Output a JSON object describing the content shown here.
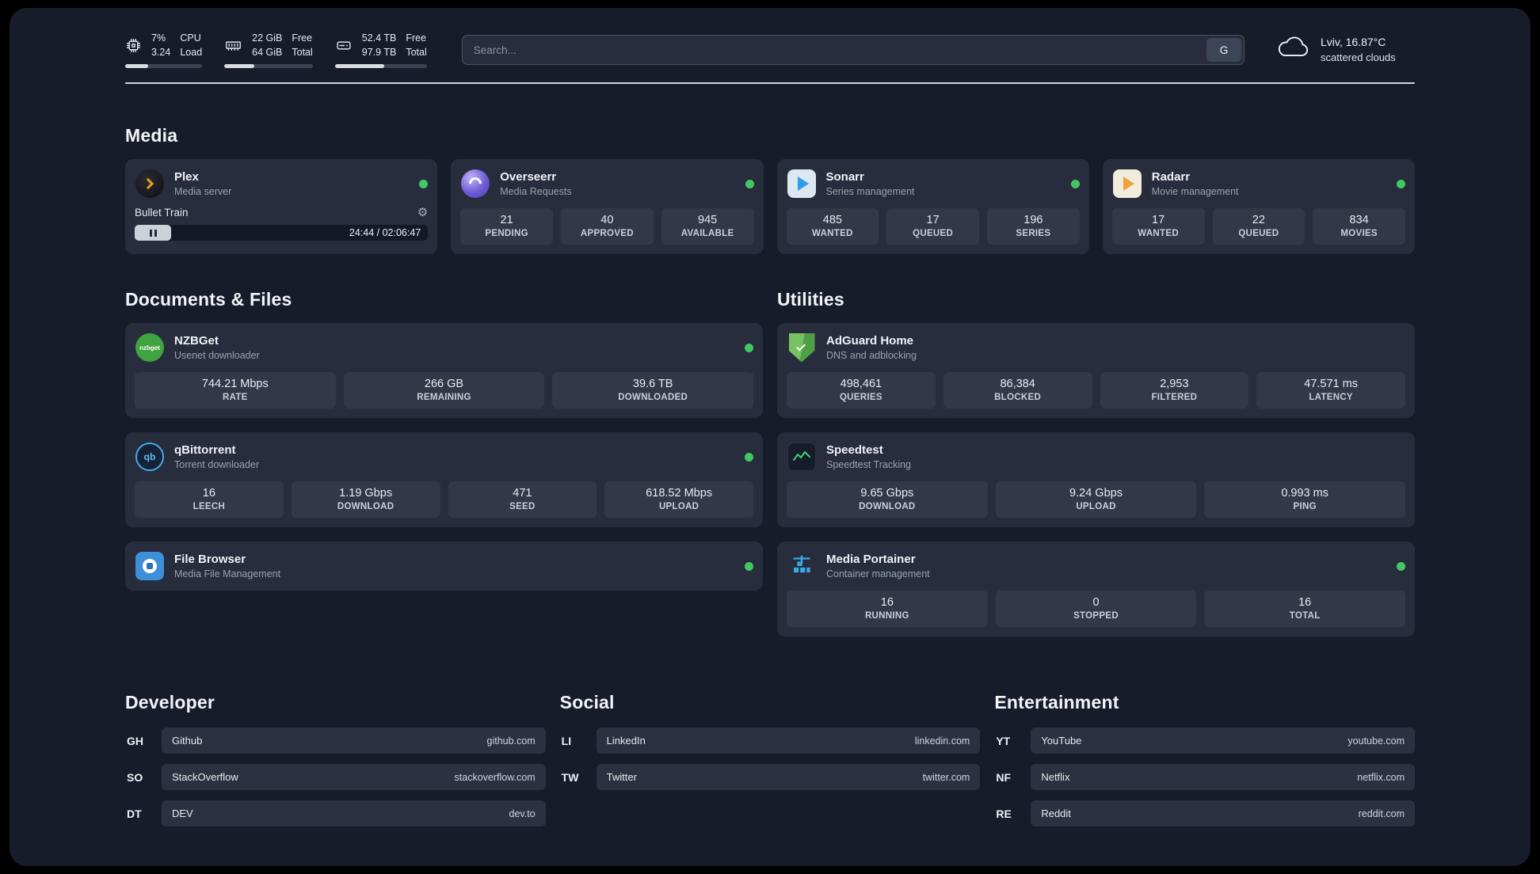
{
  "topbar": {
    "cpu": {
      "value_top": "7%",
      "value_bottom": "3.24",
      "label_top": "CPU",
      "label_bottom": "Load"
    },
    "memory": {
      "value_top": "22 GiB",
      "value_bottom": "64 GiB",
      "label_top": "Free",
      "label_bottom": "Total"
    },
    "disk": {
      "value_top": "52.4 TB",
      "value_bottom": "97.9 TB",
      "label_top": "Free",
      "label_bottom": "Total"
    },
    "search": {
      "placeholder": "Search...",
      "engine_button": "G"
    },
    "weather": {
      "location": "Lviv, 16.87°C",
      "condition": "scattered clouds"
    }
  },
  "media": {
    "title": "Media",
    "plex": {
      "name": "Plex",
      "subtitle": "Media server",
      "now_playing": "Bullet Train",
      "time": "24:44 / 02:06:47"
    },
    "overseerr": {
      "name": "Overseerr",
      "subtitle": "Media Requests",
      "stats": [
        {
          "value": "21",
          "label": "PENDING"
        },
        {
          "value": "40",
          "label": "APPROVED"
        },
        {
          "value": "945",
          "label": "AVAILABLE"
        }
      ]
    },
    "sonarr": {
      "name": "Sonarr",
      "subtitle": "Series management",
      "stats": [
        {
          "value": "485",
          "label": "WANTED"
        },
        {
          "value": "17",
          "label": "QUEUED"
        },
        {
          "value": "196",
          "label": "SERIES"
        }
      ]
    },
    "radarr": {
      "name": "Radarr",
      "subtitle": "Movie management",
      "stats": [
        {
          "value": "17",
          "label": "WANTED"
        },
        {
          "value": "22",
          "label": "QUEUED"
        },
        {
          "value": "834",
          "label": "MOVIES"
        }
      ]
    }
  },
  "documents": {
    "title": "Documents & Files",
    "nzbget": {
      "name": "NZBGet",
      "subtitle": "Usenet downloader",
      "stats": [
        {
          "value": "744.21 Mbps",
          "label": "RATE"
        },
        {
          "value": "266 GB",
          "label": "REMAINING"
        },
        {
          "value": "39.6 TB",
          "label": "DOWNLOADED"
        }
      ]
    },
    "qbittorrent": {
      "name": "qBittorrent",
      "subtitle": "Torrent downloader",
      "stats": [
        {
          "value": "16",
          "label": "LEECH"
        },
        {
          "value": "1.19 Gbps",
          "label": "DOWNLOAD"
        },
        {
          "value": "471",
          "label": "SEED"
        },
        {
          "value": "618.52 Mbps",
          "label": "UPLOAD"
        }
      ]
    },
    "filebrowser": {
      "name": "File Browser",
      "subtitle": "Media File Management"
    }
  },
  "utilities": {
    "title": "Utilities",
    "adguard": {
      "name": "AdGuard Home",
      "subtitle": "DNS and adblocking",
      "stats": [
        {
          "value": "498,461",
          "label": "QUERIES"
        },
        {
          "value": "86,384",
          "label": "BLOCKED"
        },
        {
          "value": "2,953",
          "label": "FILTERED"
        },
        {
          "value": "47.571 ms",
          "label": "LATENCY"
        }
      ]
    },
    "speedtest": {
      "name": "Speedtest",
      "subtitle": "Speedtest Tracking",
      "stats": [
        {
          "value": "9.65 Gbps",
          "label": "DOWNLOAD"
        },
        {
          "value": "9.24 Gbps",
          "label": "UPLOAD"
        },
        {
          "value": "0.993 ms",
          "label": "PING"
        }
      ]
    },
    "portainer": {
      "name": "Media Portainer",
      "subtitle": "Container management",
      "stats": [
        {
          "value": "16",
          "label": "RUNNING"
        },
        {
          "value": "0",
          "label": "STOPPED"
        },
        {
          "value": "16",
          "label": "TOTAL"
        }
      ]
    }
  },
  "bookmarks": {
    "developer": {
      "title": "Developer",
      "items": [
        {
          "abbr": "GH",
          "name": "Github",
          "url": "github.com"
        },
        {
          "abbr": "SO",
          "name": "StackOverflow",
          "url": "stackoverflow.com"
        },
        {
          "abbr": "DT",
          "name": "DEV",
          "url": "dev.to"
        }
      ]
    },
    "social": {
      "title": "Social",
      "items": [
        {
          "abbr": "LI",
          "name": "LinkedIn",
          "url": "linkedin.com"
        },
        {
          "abbr": "TW",
          "name": "Twitter",
          "url": "twitter.com"
        }
      ]
    },
    "entertainment": {
      "title": "Entertainment",
      "items": [
        {
          "abbr": "YT",
          "name": "YouTube",
          "url": "youtube.com"
        },
        {
          "abbr": "NF",
          "name": "Netflix",
          "url": "netflix.com"
        },
        {
          "abbr": "RE",
          "name": "Reddit",
          "url": "reddit.com"
        }
      ]
    }
  },
  "icons": {
    "nzbget_label": "nzbget",
    "qbittorrent_label": "qb"
  }
}
